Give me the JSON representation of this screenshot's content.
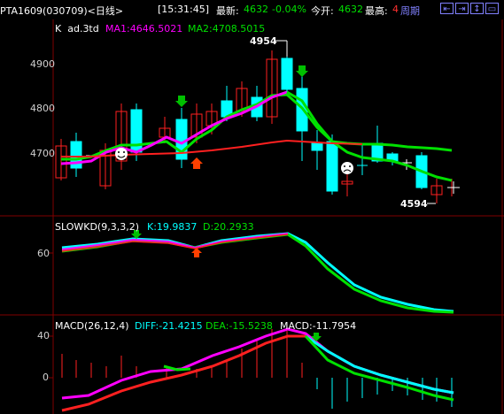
{
  "header": {
    "symbol": "PTA1609",
    "code": "(030709)",
    "period_tag": "<日线>",
    "clock": "[15:31:45]",
    "latest_label": "最新:",
    "latest_value": "4632",
    "change_pct": "-0.04%",
    "open_label": "今开:",
    "open_value": "4632",
    "high_label": "最高:",
    "high_value": "4",
    "period_button": "周期"
  },
  "nav_buttons": [
    "prev-arrow-icon",
    "next-arrow-icon",
    "zoom-in-icon",
    "zoom-out-icon"
  ],
  "colors": {
    "up": "#ff2020",
    "down": "#00ffff",
    "ma1": "#ff00ff",
    "ma2": "#00e000",
    "grid": "#800000"
  },
  "kline_panel": {
    "title": "K",
    "subtitle": "ad.3td",
    "ma1_label": "MA1:4646.5021",
    "ma2_label": "MA2:4708.5015",
    "y_ticks": [
      "4900",
      "4800",
      "4700"
    ],
    "high_marker": "4954",
    "low_marker": "4594"
  },
  "kd_panel": {
    "title": "SLOWKD(9,3,3,2)",
    "k_label": "K:19.9837",
    "d_label": "D:20.2933",
    "y_ticks": [
      "60"
    ]
  },
  "macd_panel": {
    "title": "MACD(26,12,4)",
    "diff_label": "DIFF:-21.4215",
    "dea_label": "DEA:-15.5238",
    "macd_label": "MACD:-11.7954",
    "y_ticks": [
      "40",
      "0"
    ]
  }
}
